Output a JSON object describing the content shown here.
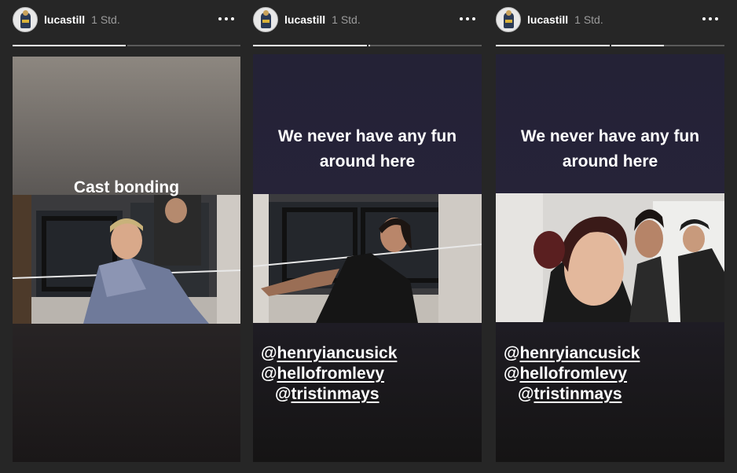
{
  "stories": [
    {
      "username": "lucastill",
      "time": "1 Std.",
      "progress": [
        1.0,
        0.0
      ],
      "caption_lines": [
        "Cast bonding"
      ],
      "mentions": []
    },
    {
      "username": "lucastill",
      "time": "1 Std.",
      "progress": [
        1.0,
        0.02
      ],
      "caption_lines": [
        "We never have any fun",
        "around here"
      ],
      "mentions": [
        {
          "at": "@",
          "handle": "henryiancusick"
        },
        {
          "at": "@",
          "handle": "hellofromlevy"
        },
        {
          "at": "@",
          "handle": "tristinmays"
        }
      ]
    },
    {
      "username": "lucastill",
      "time": "1 Std.",
      "progress": [
        1.0,
        0.47
      ],
      "caption_lines": [
        "We never have any fun",
        "around here"
      ],
      "mentions": [
        {
          "at": "@",
          "handle": "henryiancusick"
        },
        {
          "at": "@",
          "handle": "hellofromlevy"
        },
        {
          "at": "@",
          "handle": "tristinmays"
        }
      ]
    }
  ],
  "icons": {
    "more": "more-horizontal-icon",
    "avatar": "profile-avatar"
  },
  "colors": {
    "background": "#262626",
    "progress_track": "#5a5a5a",
    "progress_fill": "#ffffff",
    "time_text": "#9b9b9b"
  }
}
